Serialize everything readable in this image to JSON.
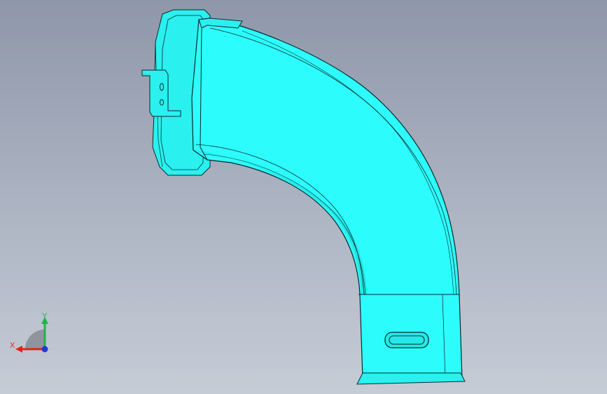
{
  "triad": {
    "x_label": "X",
    "y_label": "Y"
  },
  "colors": {
    "model_fill": "#2dfcfc",
    "model_shade": "#1fd9d9",
    "model_edge": "#0b2a2a",
    "x_axis": "#e0241b",
    "y_axis": "#22b34a",
    "z_axis": "#2038d6"
  }
}
